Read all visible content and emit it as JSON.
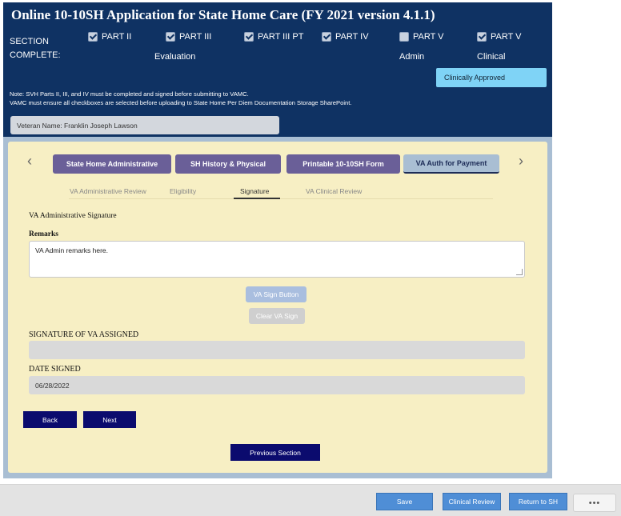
{
  "header": {
    "title": "Online 10-10SH Application for State Home Care (FY 2021 version 4.1.1)",
    "section_label_1": "SECTION",
    "section_label_2": "COMPLETE:",
    "parts": [
      {
        "label": "PART II",
        "sub": "",
        "checked": true
      },
      {
        "label": "PART III",
        "sub": "Evaluation",
        "checked": true
      },
      {
        "label": "PART III PT",
        "sub": "",
        "checked": true
      },
      {
        "label": "PART IV",
        "sub": "",
        "checked": true
      },
      {
        "label": "PART V",
        "sub": "Admin",
        "checked": false
      },
      {
        "label": "PART V",
        "sub": "Clinical",
        "checked": true
      }
    ],
    "clinical_status": "Clinically Approved",
    "note_line1": "Note: SVH Parts II, III, and IV must be completed and signed before submitting to VAMC.",
    "note_line2": "VAMC must ensure all checkboxes are selected before uploading to State Home Per Diem Documentation Storage SharePoint.",
    "veteran_name": "Veteran Name: Franklin Joseph Lawson"
  },
  "nav": {
    "prev_icon": "chevron-left-icon",
    "next_icon": "chevron-right-icon",
    "tabs": [
      {
        "label": "State Home Administrative",
        "active": false
      },
      {
        "label": "SH History & Physical",
        "active": false
      },
      {
        "label": "Printable 10-10SH Form",
        "active": false
      },
      {
        "label": "VA Auth for Payment",
        "active": true
      }
    ],
    "subtabs": [
      {
        "label": "VA Administrative Review",
        "active": false
      },
      {
        "label": "Eligibility",
        "active": false
      },
      {
        "label": "Signature",
        "active": true
      },
      {
        "label": "VA Clinical Review",
        "active": false
      }
    ]
  },
  "form": {
    "heading": "VA Administrative Signature",
    "remarks_label": "Remarks",
    "remarks_value": "VA Admin remarks here.",
    "sign_button": "VA Sign Button",
    "clear_button": "Clear VA Sign",
    "signature_label": "SIGNATURE OF VA ASSIGNED",
    "signature_value": "",
    "date_label": "DATE SIGNED",
    "date_value": "06/28/2022",
    "back_button": "Back",
    "next_button": "Next",
    "previous_section_button": "Previous Section"
  },
  "footer": {
    "save": "Save",
    "clinical_review": "Clinical Review",
    "return_to_sh": "Return to SH",
    "more": "•••"
  },
  "colors": {
    "header_bg": "#0f3263",
    "tab_bg": "#6a5f98",
    "form_bg": "#f7efc4",
    "navy_button": "#0b0b6e",
    "footer_button": "#4f8ed6",
    "status_badge": "#7fd3f6"
  }
}
